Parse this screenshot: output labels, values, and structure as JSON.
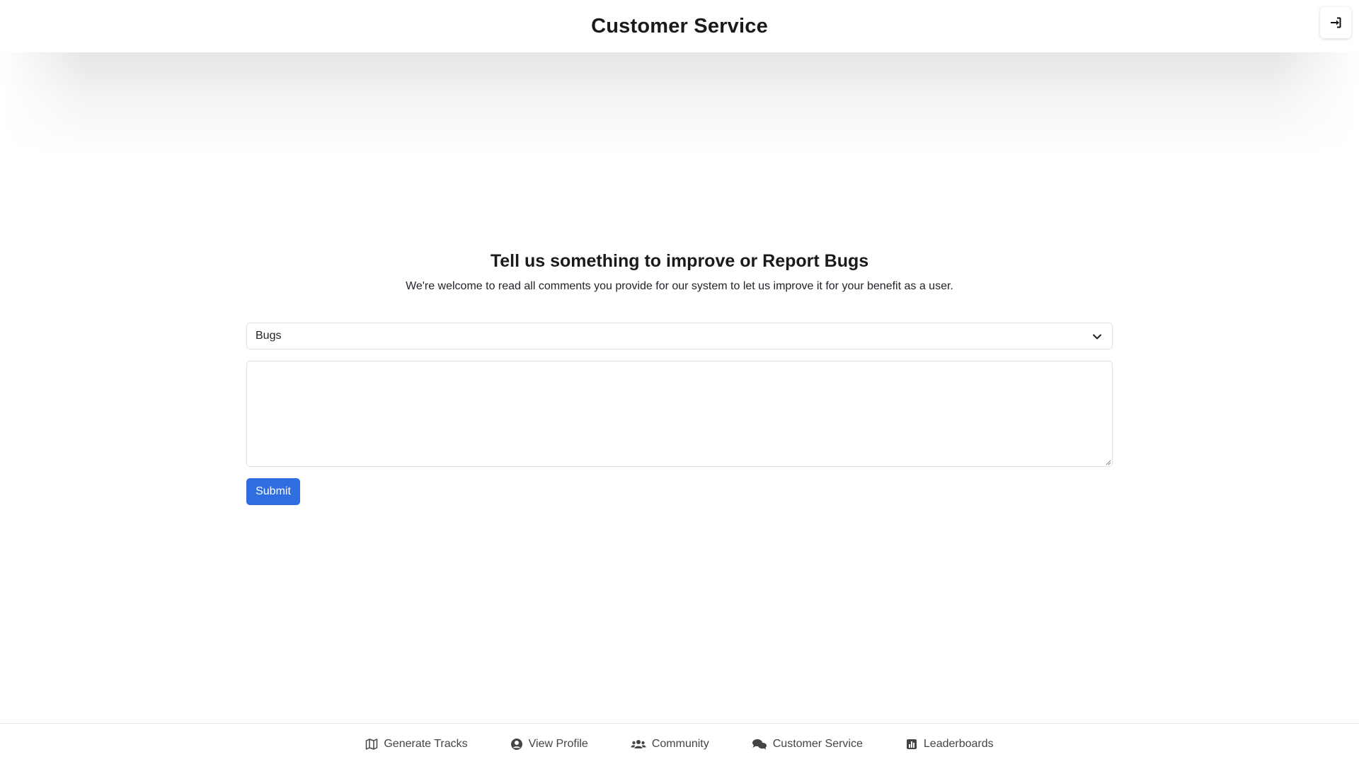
{
  "header": {
    "title": "Customer Service",
    "login_icon": "sign-in-icon"
  },
  "main": {
    "heading": "Tell us something to improve or Report Bugs",
    "subtext": "We're welcome to read all comments you provide for our system to let us improve it for your benefit as a user.",
    "category_select": {
      "selected": "Bugs",
      "icon": "chevron-down-icon"
    },
    "comment_field": {
      "value": "",
      "placeholder": ""
    },
    "submit_label": "Submit"
  },
  "footer": {
    "items": [
      {
        "label": "Generate Tracks",
        "icon": "map-icon"
      },
      {
        "label": "View Profile",
        "icon": "user-circle-icon"
      },
      {
        "label": "Community",
        "icon": "users-icon"
      },
      {
        "label": "Customer Service",
        "icon": "comments-icon"
      },
      {
        "label": "Leaderboards",
        "icon": "chart-icon"
      }
    ]
  },
  "colors": {
    "accent": "#2f6de1",
    "text": "#212529",
    "border": "#dee2e6"
  }
}
